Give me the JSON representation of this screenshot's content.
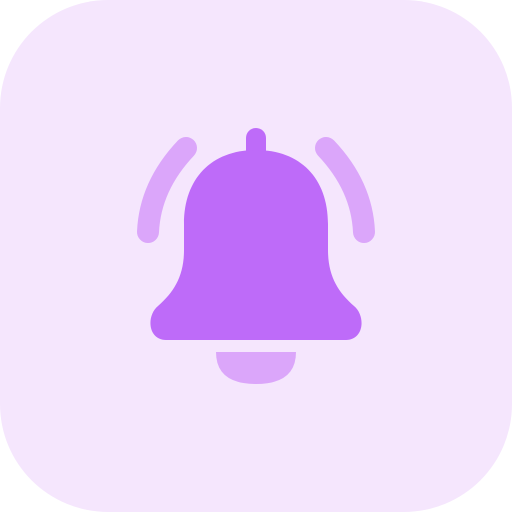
{
  "icon": {
    "name": "notification-bell-icon",
    "colors": {
      "background": "#f5e6fd",
      "bell": "#be6bf9",
      "accent": "#dba6fa"
    }
  }
}
